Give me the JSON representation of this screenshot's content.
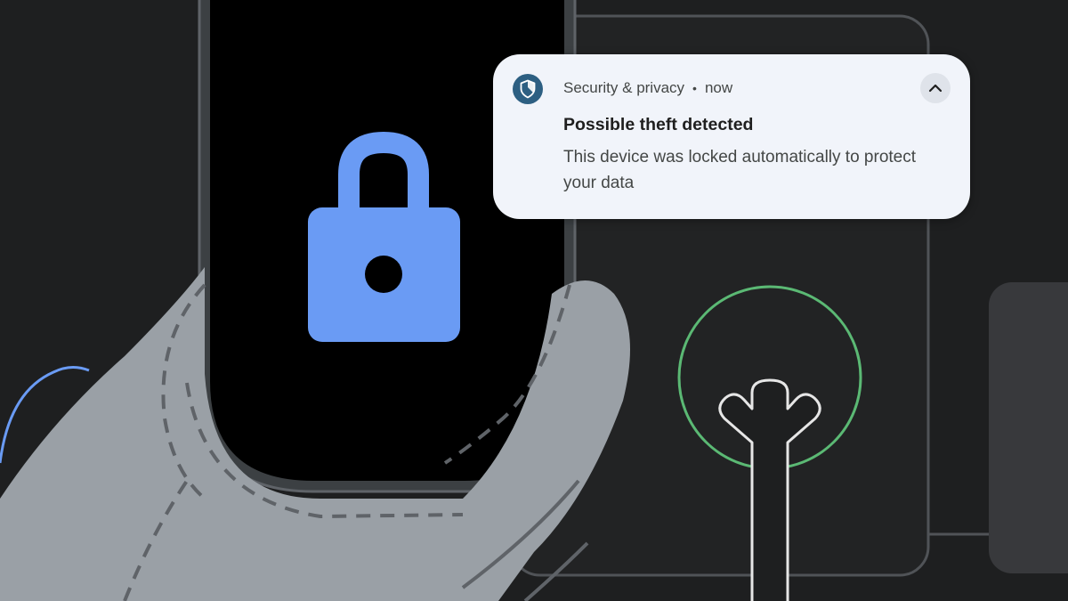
{
  "notification": {
    "app_icon": "shield-icon",
    "app_name": "Security & privacy",
    "separator": "•",
    "timestamp": "now",
    "title": "Possible theft detected",
    "body": "This device was locked automatically to protect your data",
    "expand_icon": "chevron-up-icon"
  },
  "illustration": {
    "phone_screen_icon": "lock-icon",
    "fingerprint_sensor_icon": "fingerprint-icon"
  },
  "colors": {
    "background": "#1e1f20",
    "notification_surface": "#f1f4fa",
    "app_icon_bg": "#2d5f82",
    "lock_blue": "#6a9bf4",
    "sensor_ring_green": "#5bb974",
    "hand_gray": "#9aa0a6",
    "outline_gray": "#5f6368"
  }
}
